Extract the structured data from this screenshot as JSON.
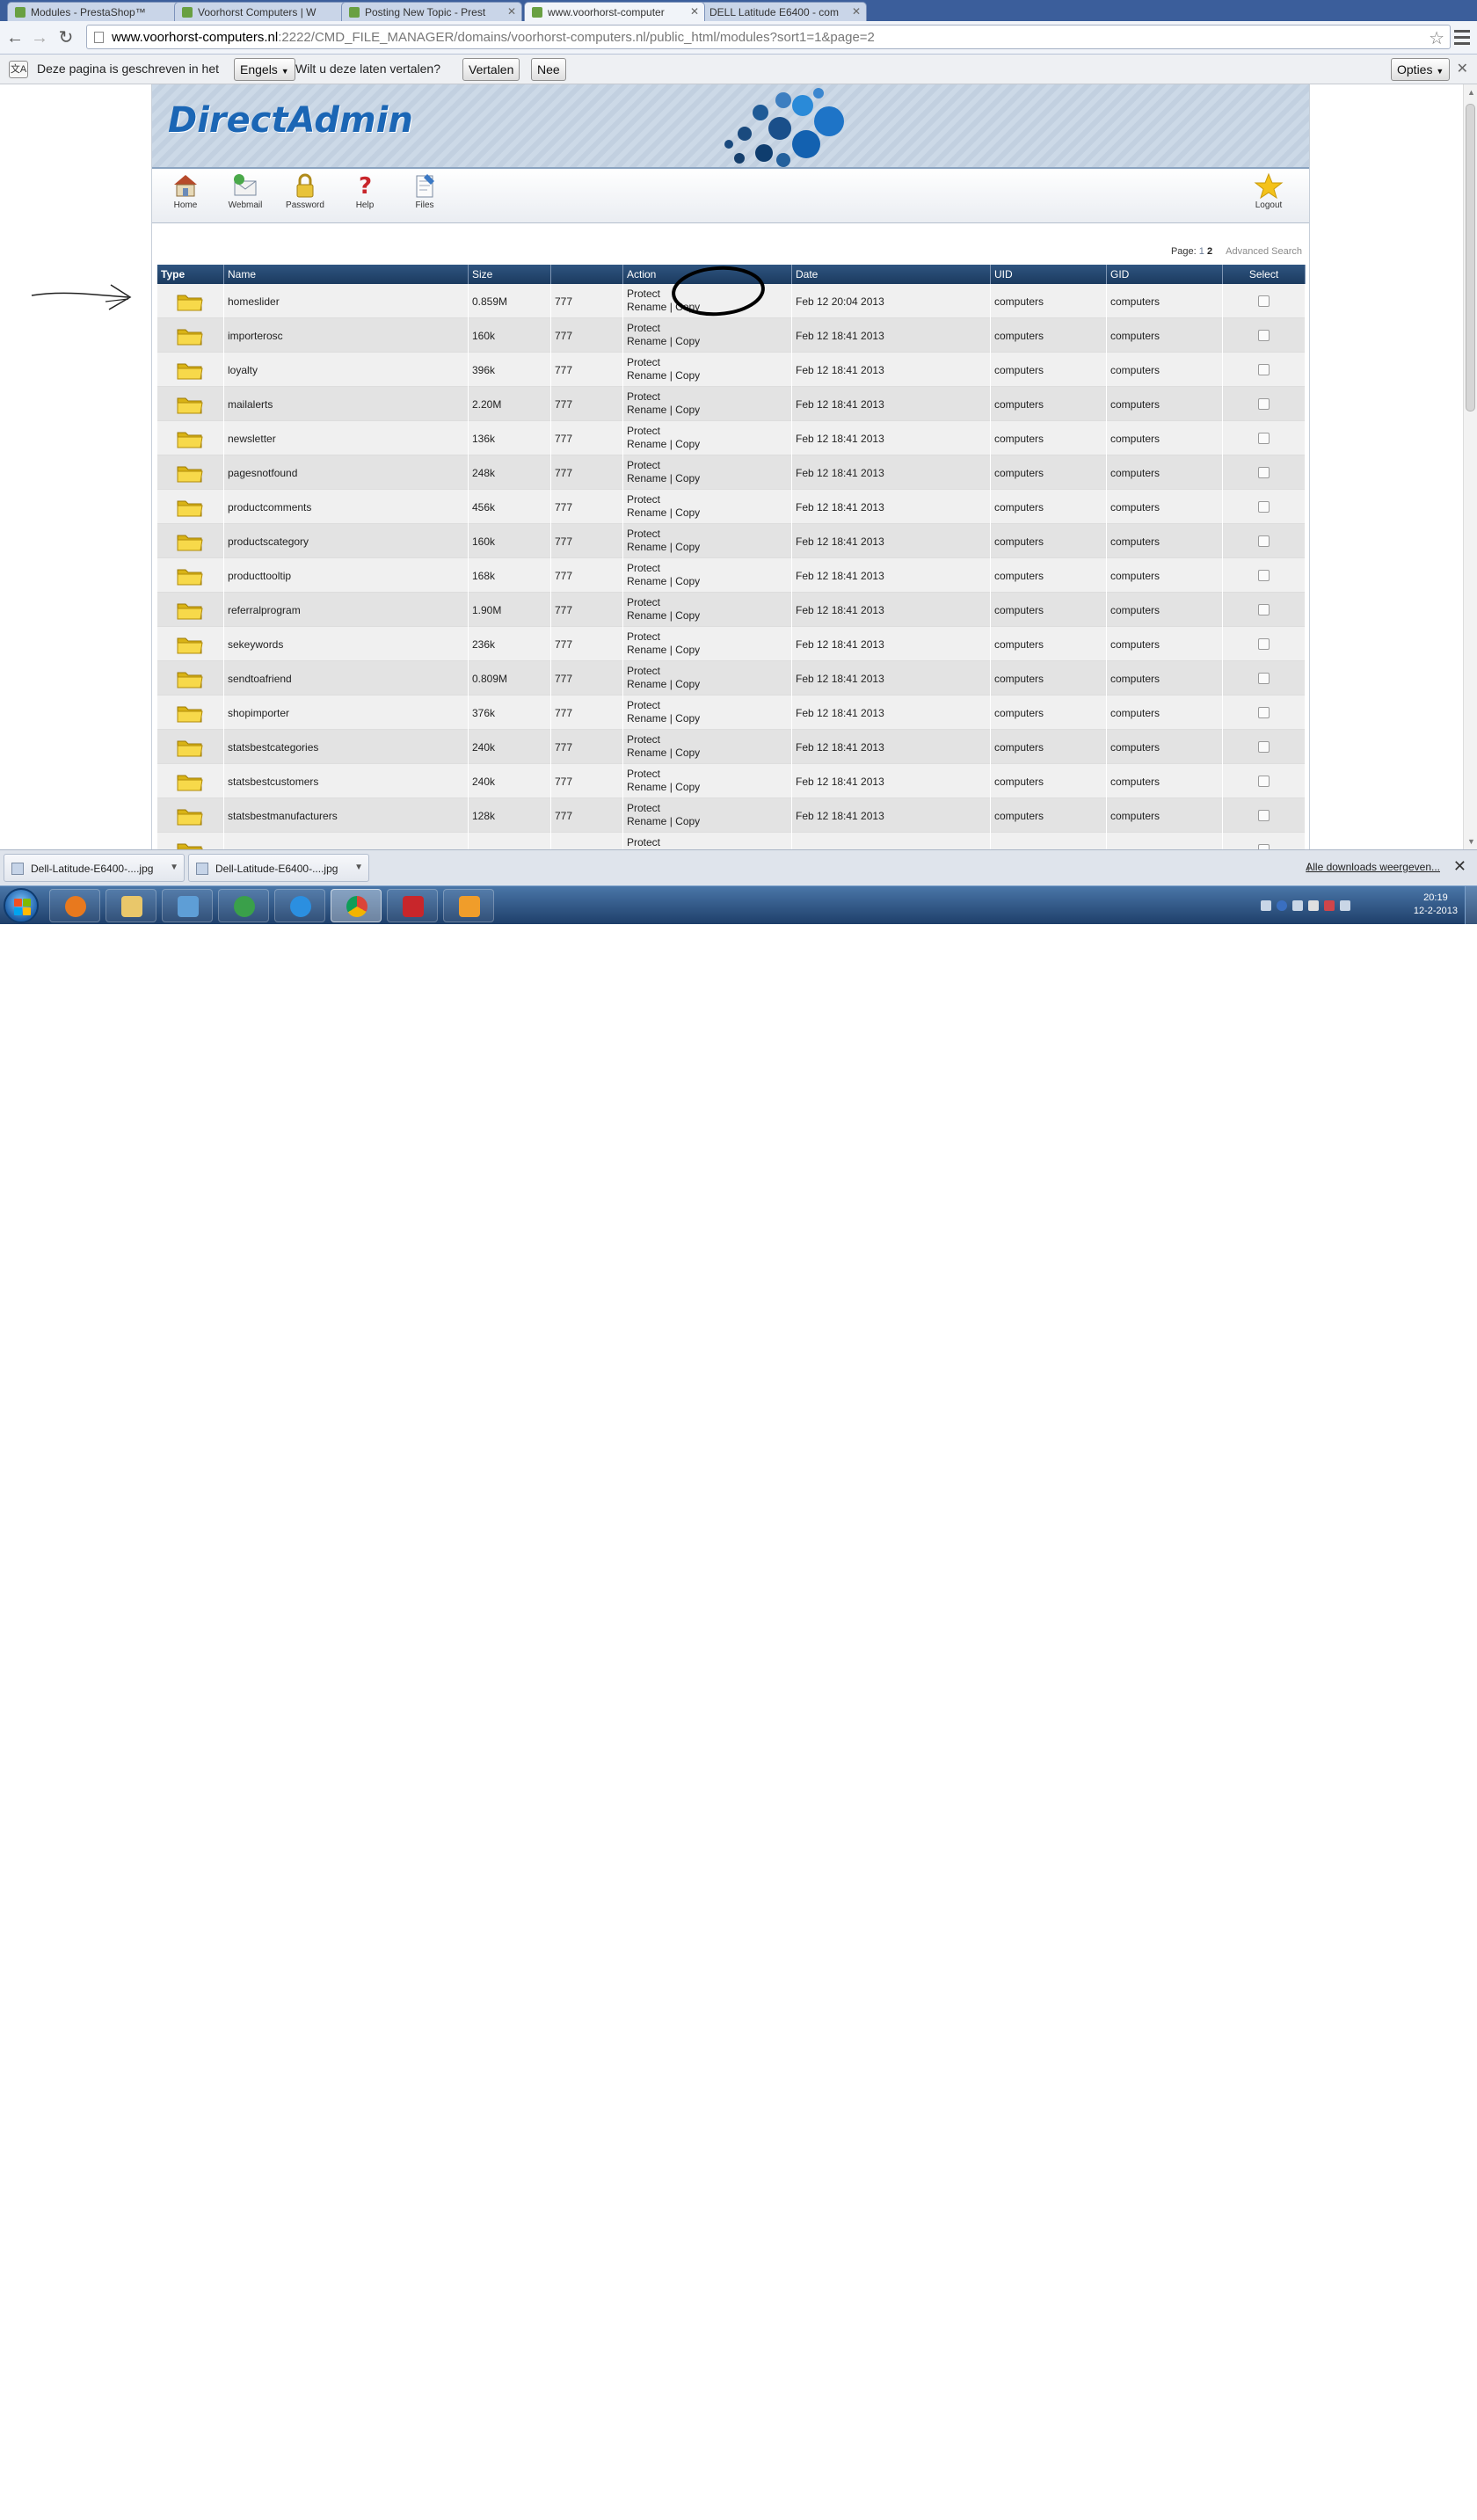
{
  "browser": {
    "tabs": [
      {
        "title": "Modules - PrestaShop™",
        "active": false
      },
      {
        "title": "Voorhorst Computers | W",
        "active": false
      },
      {
        "title": "Posting New Topic - Prest",
        "active": false
      },
      {
        "title": "www.voorhorst-computer",
        "active": true
      },
      {
        "title": "DELL Latitude E6400 - com",
        "active": false
      }
    ],
    "url_host": "www.voorhorst-computers.nl",
    "url_path": ":2222/CMD_FILE_MANAGER/domains/voorhorst-computers.nl/public_html/modules?sort1=1&page=2"
  },
  "translate": {
    "prefix": "Deze pagina is geschreven in het",
    "language": "Engels",
    "question": "Wilt u deze laten vertalen?",
    "translate_btn": "Vertalen",
    "no_btn": "Nee",
    "options_btn": "Opties"
  },
  "da": {
    "logo": "DirectAdmin",
    "nav": [
      {
        "label": "Home",
        "icon": "home-icon"
      },
      {
        "label": "Webmail",
        "icon": "webmail-icon"
      },
      {
        "label": "Password",
        "icon": "lock-icon"
      },
      {
        "label": "Help",
        "icon": "help-icon"
      },
      {
        "label": "Files",
        "icon": "files-icon"
      }
    ],
    "logout": "Logout",
    "pager": {
      "label": "Page:",
      "page1": "1",
      "page2": "2",
      "advanced": "Advanced Search"
    },
    "columns": [
      "Type",
      "Name",
      "Size",
      "",
      "Action",
      "Date",
      "UID",
      "GID",
      "Select"
    ],
    "rows": [
      {
        "name": "homeslider",
        "size": "0.859M",
        "perm": "777",
        "date": "Feb 12 20:04 2013",
        "uid": "computers",
        "gid": "computers"
      },
      {
        "name": "importerosc",
        "size": "160k",
        "perm": "777",
        "date": "Feb 12 18:41 2013",
        "uid": "computers",
        "gid": "computers"
      },
      {
        "name": "loyalty",
        "size": "396k",
        "perm": "777",
        "date": "Feb 12 18:41 2013",
        "uid": "computers",
        "gid": "computers"
      },
      {
        "name": "mailalerts",
        "size": "2.20M",
        "perm": "777",
        "date": "Feb 12 18:41 2013",
        "uid": "computers",
        "gid": "computers"
      },
      {
        "name": "newsletter",
        "size": "136k",
        "perm": "777",
        "date": "Feb 12 18:41 2013",
        "uid": "computers",
        "gid": "computers"
      },
      {
        "name": "pagesnotfound",
        "size": "248k",
        "perm": "777",
        "date": "Feb 12 18:41 2013",
        "uid": "computers",
        "gid": "computers"
      },
      {
        "name": "productcomments",
        "size": "456k",
        "perm": "777",
        "date": "Feb 12 18:41 2013",
        "uid": "computers",
        "gid": "computers"
      },
      {
        "name": "productscategory",
        "size": "160k",
        "perm": "777",
        "date": "Feb 12 18:41 2013",
        "uid": "computers",
        "gid": "computers"
      },
      {
        "name": "producttooltip",
        "size": "168k",
        "perm": "777",
        "date": "Feb 12 18:41 2013",
        "uid": "computers",
        "gid": "computers"
      },
      {
        "name": "referralprogram",
        "size": "1.90M",
        "perm": "777",
        "date": "Feb 12 18:41 2013",
        "uid": "computers",
        "gid": "computers"
      },
      {
        "name": "sekeywords",
        "size": "236k",
        "perm": "777",
        "date": "Feb 12 18:41 2013",
        "uid": "computers",
        "gid": "computers"
      },
      {
        "name": "sendtoafriend",
        "size": "0.809M",
        "perm": "777",
        "date": "Feb 12 18:41 2013",
        "uid": "computers",
        "gid": "computers"
      },
      {
        "name": "shopimporter",
        "size": "376k",
        "perm": "777",
        "date": "Feb 12 18:41 2013",
        "uid": "computers",
        "gid": "computers"
      },
      {
        "name": "statsbestcategories",
        "size": "240k",
        "perm": "777",
        "date": "Feb 12 18:41 2013",
        "uid": "computers",
        "gid": "computers"
      },
      {
        "name": "statsbestcustomers",
        "size": "240k",
        "perm": "777",
        "date": "Feb 12 18:41 2013",
        "uid": "computers",
        "gid": "computers"
      },
      {
        "name": "statsbestmanufacturers",
        "size": "128k",
        "perm": "777",
        "date": "Feb 12 18:41 2013",
        "uid": "computers",
        "gid": "computers"
      },
      {
        "name": "",
        "size": "",
        "perm": "",
        "date": "",
        "uid": "",
        "gid": ""
      }
    ],
    "action_protect": "Protect",
    "action_rename": "Rename",
    "action_sep": "|",
    "action_copy": "Copy"
  },
  "downloads": {
    "items": [
      "Dell-Latitude-E6400-....jpg",
      "Dell-Latitude-E6400-....jpg"
    ],
    "show_all": "Alle downloads weergeven..."
  },
  "taskbar": {
    "time": "20:19",
    "date": "12-2-2013"
  },
  "colors": {
    "header_blue": "#1b3a5f",
    "logo_blue": "#1b66b5",
    "row_odd": "#f0f0f0",
    "row_even": "#e3e3e3"
  }
}
